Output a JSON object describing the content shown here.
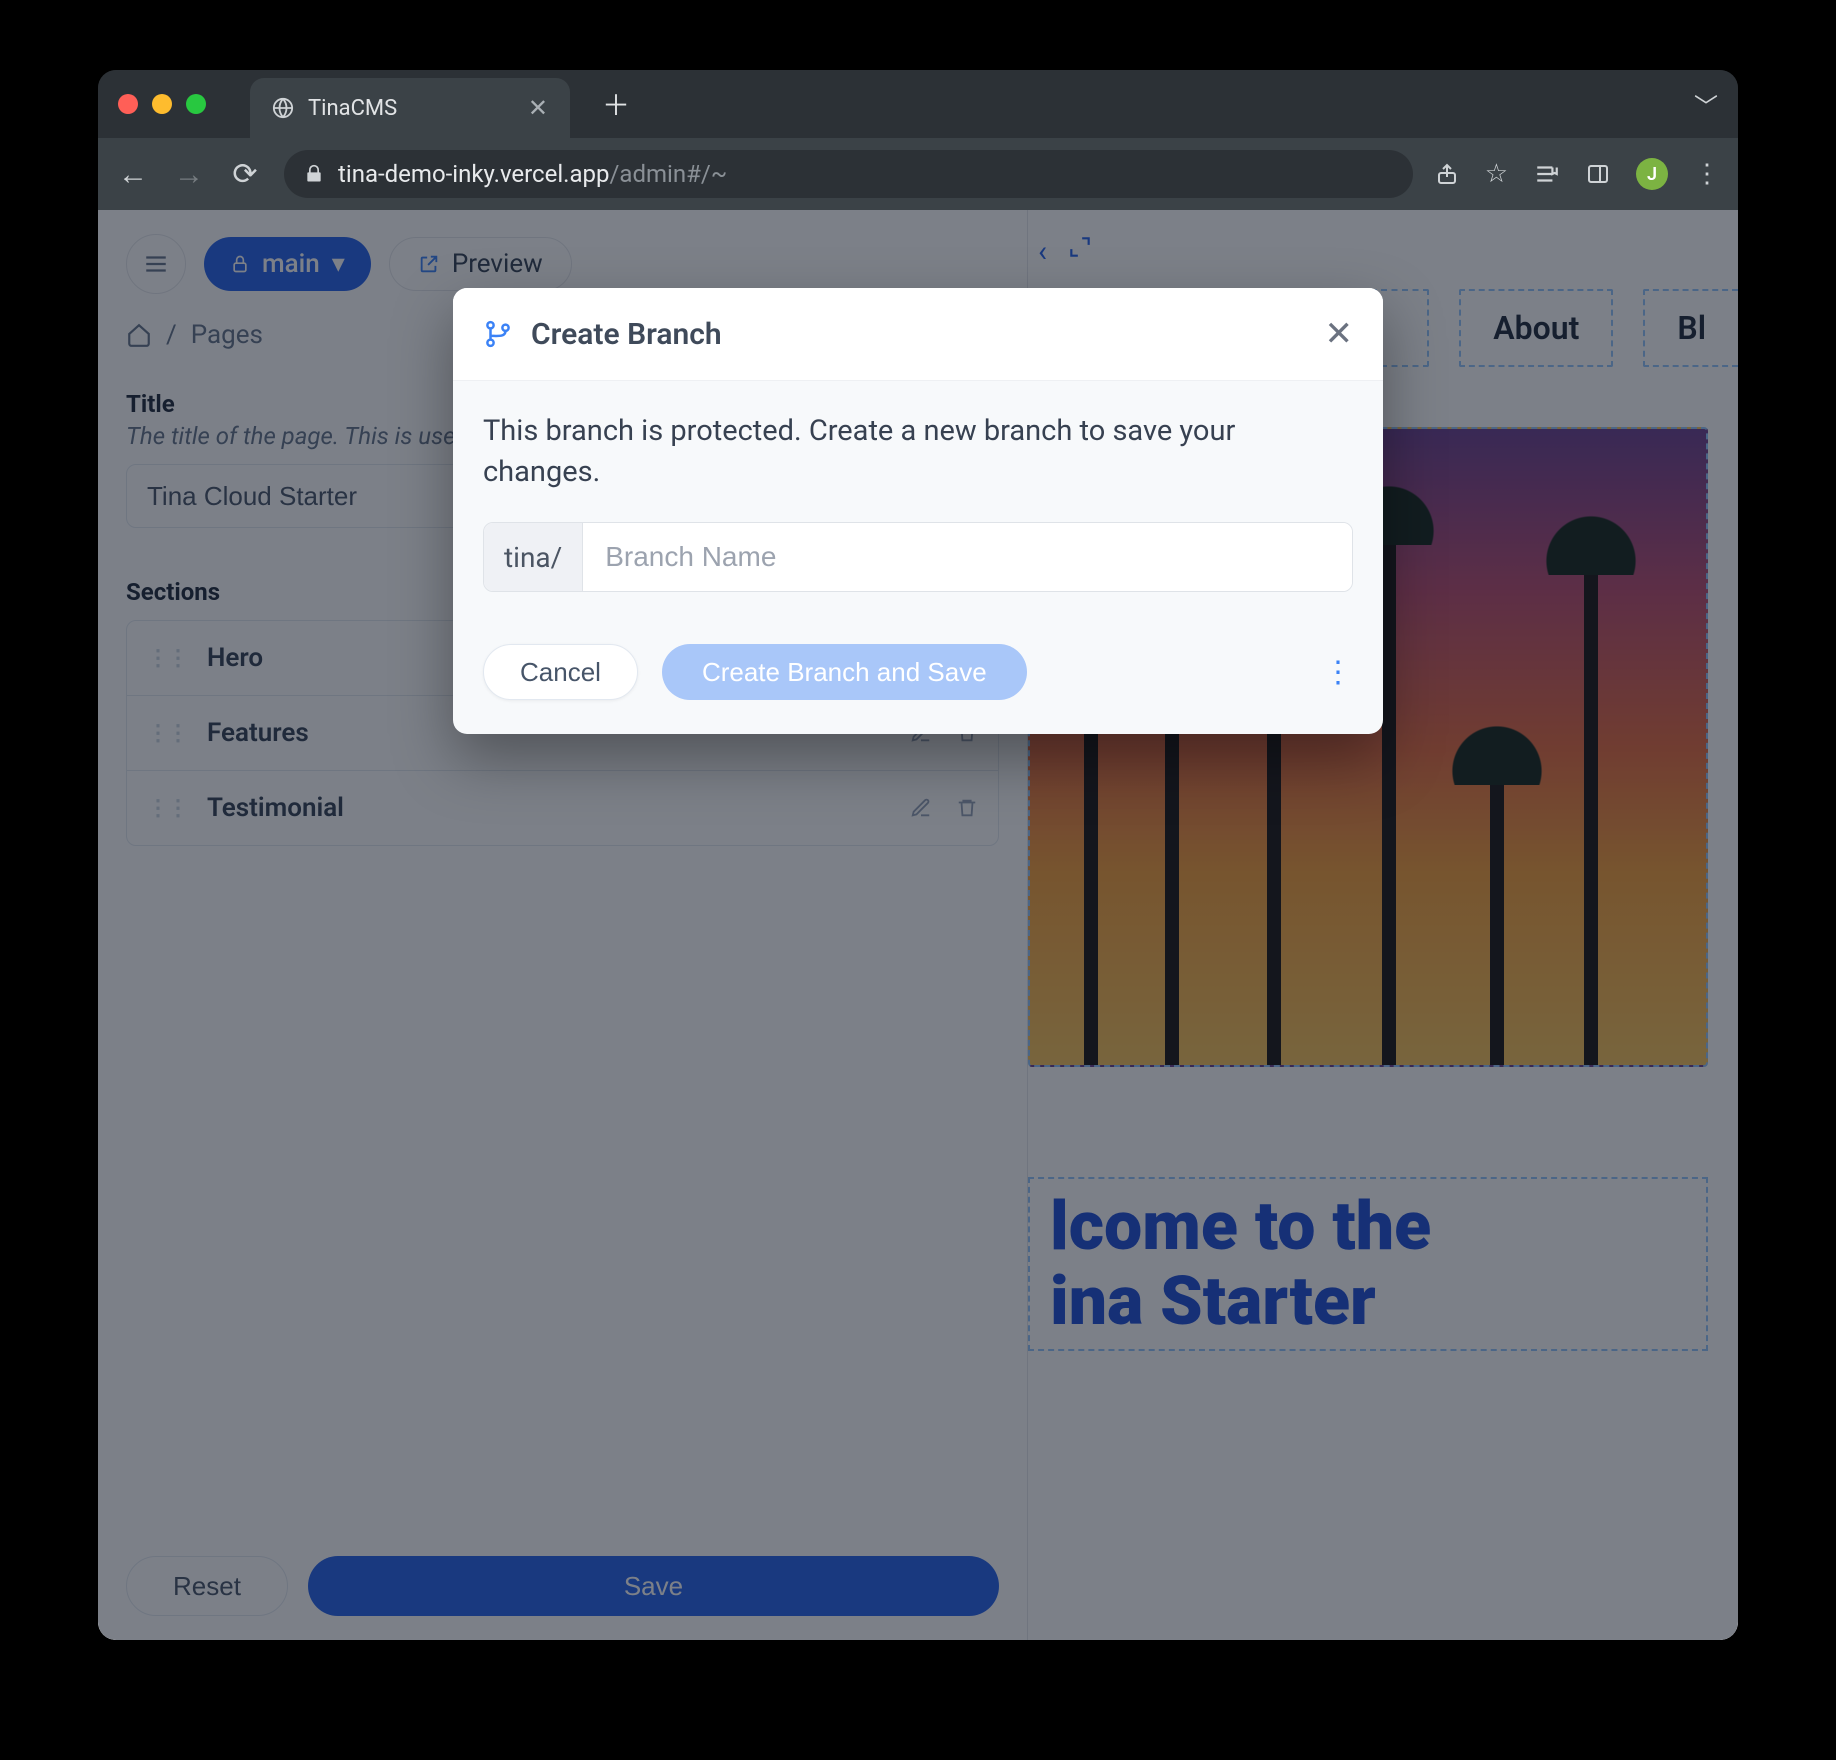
{
  "browser": {
    "tab_title": "TinaCMS",
    "url_host": "tina-demo-inky.vercel.app",
    "url_path": "/admin#/~",
    "avatar_initial": "J"
  },
  "topbar": {
    "branch_label": "main",
    "preview_label": "Preview"
  },
  "breadcrumb": {
    "page": "Pages"
  },
  "fields": {
    "title_label": "Title",
    "title_help": "The title of the page. This is used to display the…",
    "title_value": "Tina Cloud Starter",
    "sections_label": "Sections",
    "sections": [
      {
        "name": "Hero"
      },
      {
        "name": "Features"
      },
      {
        "name": "Testimonial"
      }
    ]
  },
  "buttons": {
    "reset": "Reset",
    "save": "Save"
  },
  "preview_nav": {
    "about": "About",
    "blog": "Bl"
  },
  "hero_headline_line1": "lcome to the",
  "hero_headline_line2": "ina Starter",
  "modal": {
    "title": "Create Branch",
    "message": "This branch is protected. Create a new branch to save your changes.",
    "prefix": "tina/",
    "placeholder": "Branch Name",
    "cancel": "Cancel",
    "submit": "Create Branch and Save"
  }
}
